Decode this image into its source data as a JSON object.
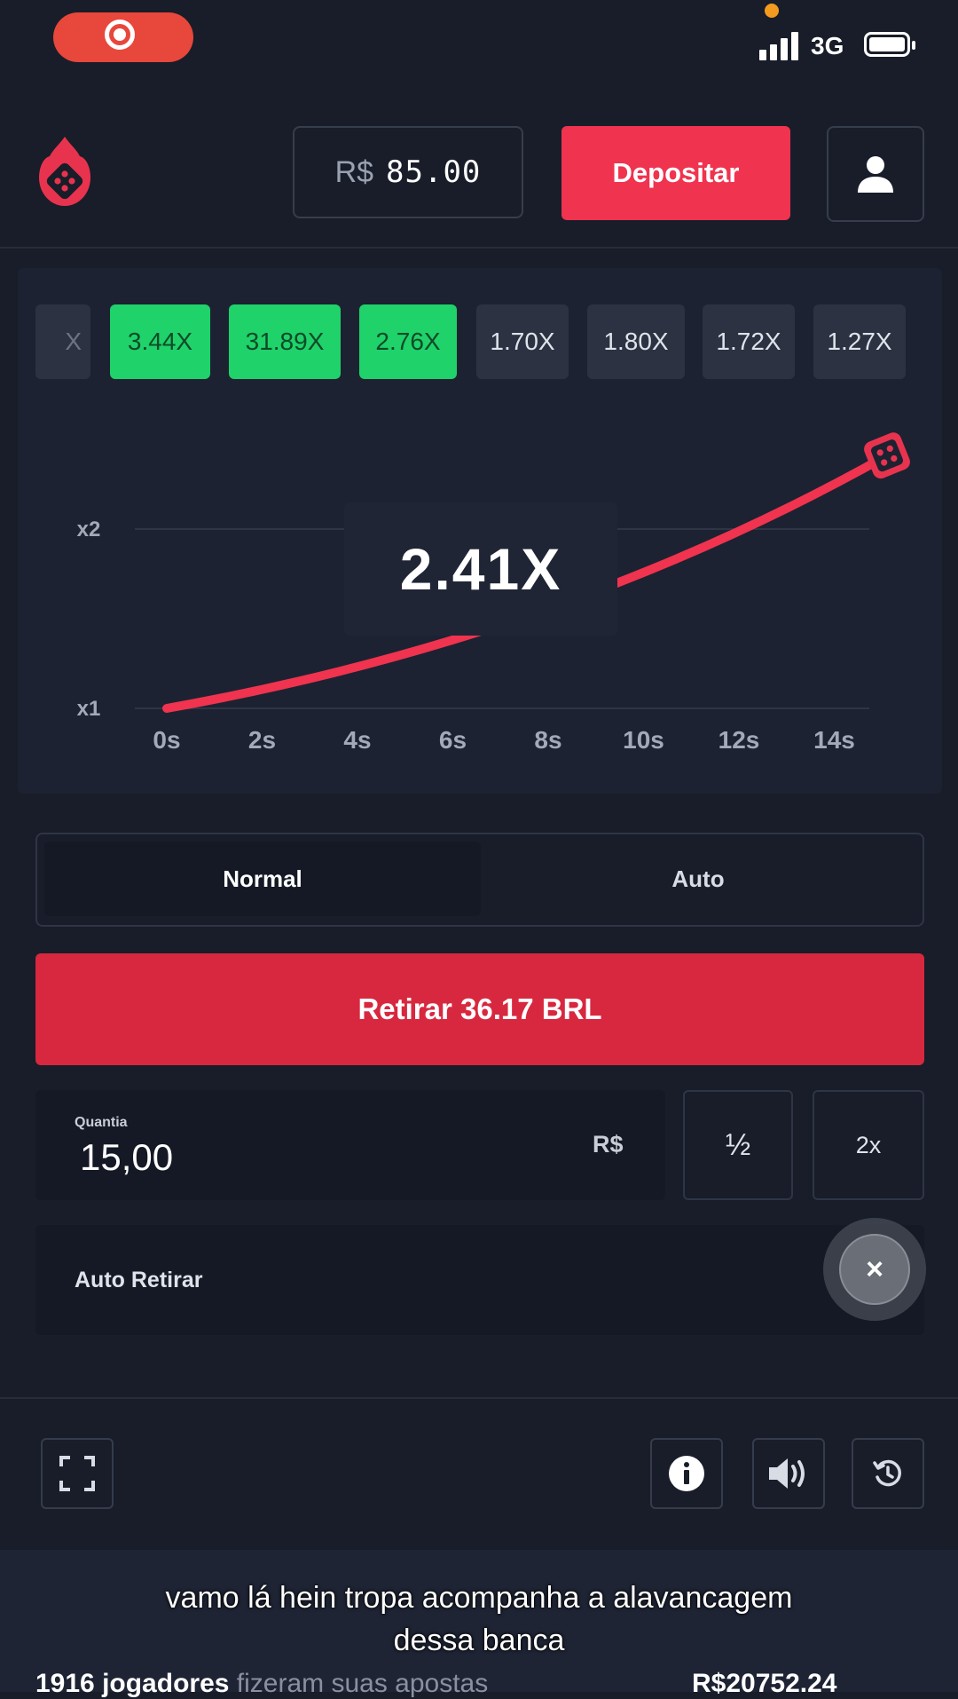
{
  "status_bar": {
    "network": "3G",
    "icons": [
      "screen-record-icon",
      "signal-icon",
      "battery-icon"
    ]
  },
  "header": {
    "currency": "R$",
    "balance": "85.00",
    "deposit_label": "Depositar",
    "icons": [
      "dice-fire-logo-icon",
      "user-icon"
    ]
  },
  "history": [
    "X",
    "3.44X",
    "31.89X",
    "2.76X",
    "1.70X",
    "1.80X",
    "1.72X",
    "1.27X"
  ],
  "game": {
    "multiplier": "2.41X",
    "y_labels": [
      "x2",
      "x1"
    ]
  },
  "chart_data": {
    "type": "line",
    "x_ticks": [
      "0s",
      "2s",
      "4s",
      "6s",
      "8s",
      "10s",
      "12s",
      "14s"
    ],
    "y_ticks": [
      "x1",
      "x2"
    ],
    "series": [
      {
        "x": [
          0,
          14.5
        ],
        "y": [
          1,
          2.41
        ]
      }
    ],
    "xlim": [
      0,
      14.5
    ],
    "ylim": [
      1,
      2.41
    ],
    "grid": true,
    "current_multiplier": 2.41,
    "colors": {
      "line": "#f0334f",
      "green": "#1fd26a",
      "accent": "#f0334f"
    }
  },
  "controls": {
    "tab_normal": "Normal",
    "tab_auto": "Auto",
    "cashout_label": "Retirar 36.17 BRL",
    "amount_label": "Quantia",
    "amount_value": "15,00",
    "amount_currency": "R$",
    "half_label": "½",
    "double_label": "2x",
    "auto_cashout_label": "Auto Retirar",
    "toggle_symbol": "×"
  },
  "toolbar": {
    "icons": [
      "fullscreen-icon",
      "info-icon",
      "sound-icon",
      "history-icon"
    ]
  },
  "footer": {
    "caption_line1": "vamo lá hein tropa acompanha a alavancagem",
    "caption_line2": "dessa banca",
    "players_count": "1916 jogadores",
    "players_text": " fizeram suas apostas",
    "pool_amount": "R$20752.24"
  }
}
